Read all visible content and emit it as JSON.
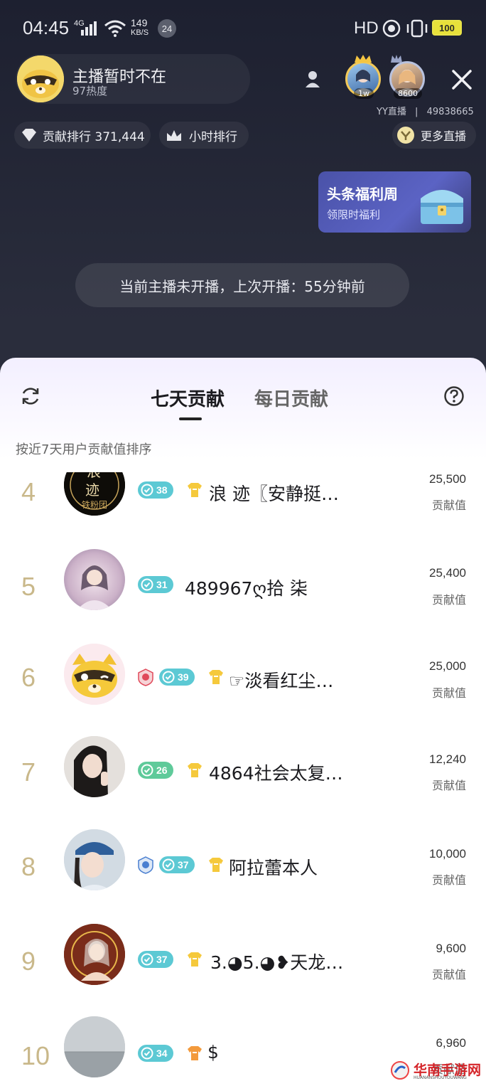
{
  "status": {
    "time": "04:45",
    "net_type": "4G",
    "speed_value": "149",
    "speed_unit": "KB/S",
    "notif_count": "24",
    "hd": "HD",
    "battery": "100"
  },
  "host": {
    "name": "主播暂时不在",
    "heat": "97热度"
  },
  "viewers": [
    {
      "tag": "1w"
    },
    {
      "tag": "8600"
    }
  ],
  "room": {
    "platform": "YY直播",
    "separator": "|",
    "room_id": "49838665"
  },
  "chips": {
    "contrib_rank": "贡献排行 371,444",
    "hour_rank": "小时排行",
    "more_live": "更多直播"
  },
  "promo": {
    "title": "头条福利周",
    "subtitle": "领限时福利"
  },
  "notice": "当前主播未开播，上次开播：55分钟前",
  "sheet": {
    "tab_active": "七天贡献",
    "tab_inactive": "每日贡献",
    "subtitle": "按近7天用户贡献值排序",
    "score_label": "贡献值"
  },
  "ranking": [
    {
      "rank": "4",
      "level": "38",
      "name": "浪 迹〖安静挺…",
      "score": "25,500"
    },
    {
      "rank": "5",
      "level": "31",
      "name": "489967ღ拾 柒",
      "score": "25,400"
    },
    {
      "rank": "6",
      "level": "39",
      "name": "☞淡看红尘…",
      "score": "25,000"
    },
    {
      "rank": "7",
      "level": "26",
      "name": "4864社会太复…",
      "score": "12,240"
    },
    {
      "rank": "8",
      "level": "37",
      "name": "阿拉蕾本人",
      "score": "10,000"
    },
    {
      "rank": "9",
      "level": "37",
      "name": "3.◕5.◕❥天龙…",
      "score": "9,600"
    },
    {
      "rank": "10",
      "level": "34",
      "name": "$",
      "score": "6,960"
    }
  ],
  "avatar_texts": {
    "r4_line1": "浪",
    "r4_line2": "迹",
    "r4_line3": "铁粉团"
  },
  "watermark": {
    "name": "华南手游网",
    "url": "HUANANSHOUYOUWANG"
  },
  "colors": {
    "rank_gold": "#c9b88a",
    "level_blue": "#5cc9d4",
    "level_green": "#5fca9a",
    "battery_yellow": "#e8e13b"
  }
}
